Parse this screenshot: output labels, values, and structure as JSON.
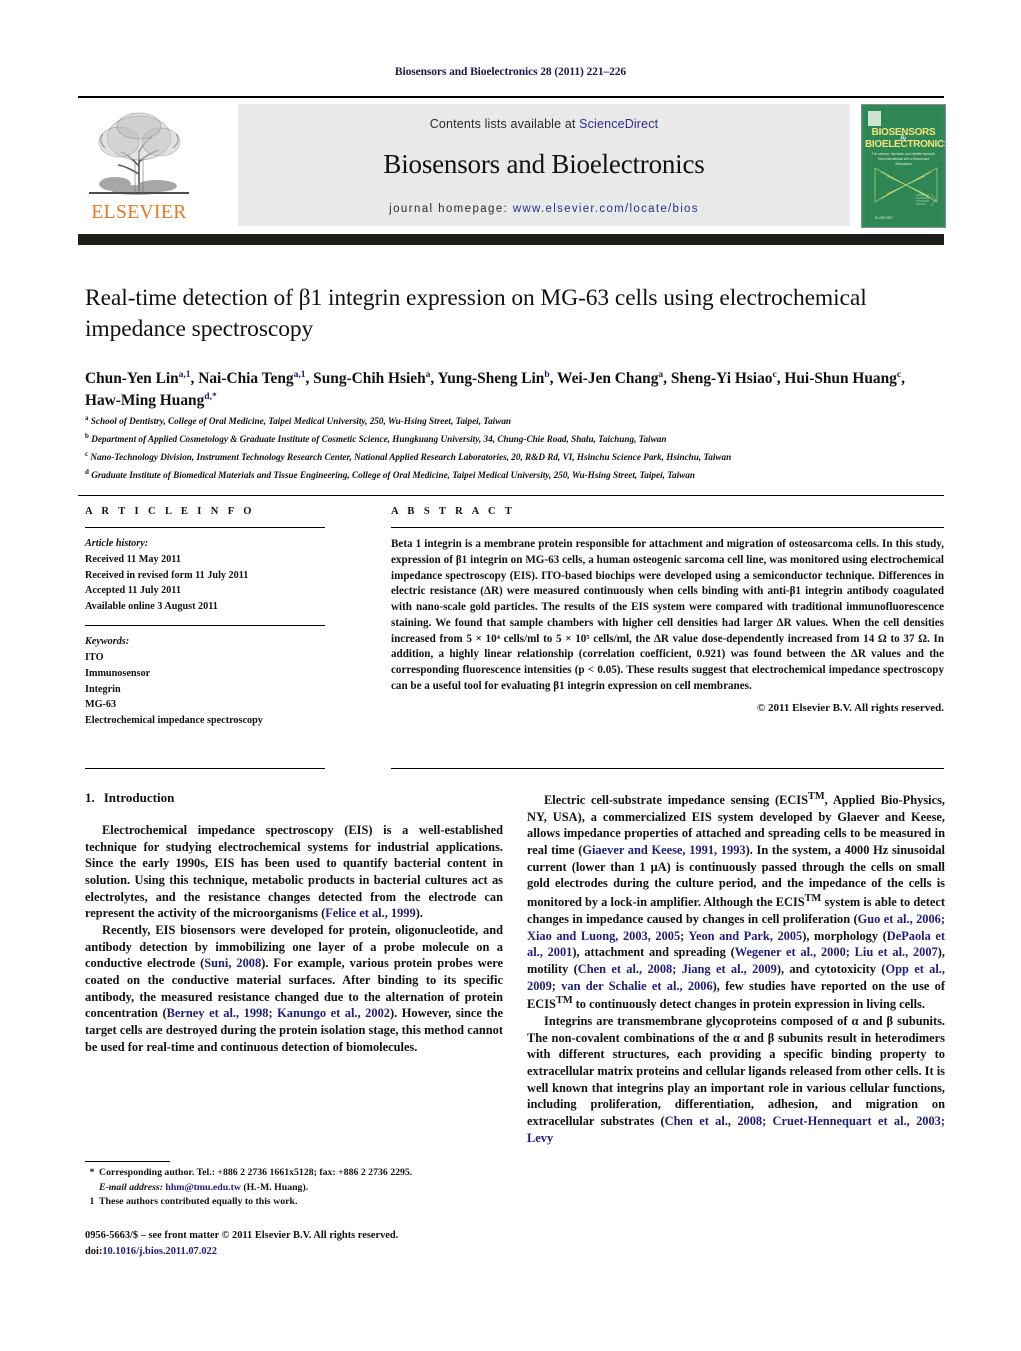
{
  "running_head": "Biosensors and Bioelectronics 28 (2011) 221–226",
  "masthead": {
    "contents_prefix": "Contents lists available at ",
    "sciencedirect": "ScienceDirect",
    "journal_name": "Biosensors and Bioelectronics",
    "homepage_label": "journal homepage:",
    "homepage_url": "www.elsevier.com/locate/bios",
    "publisher_logo_text": "ELSEVIER",
    "cover": {
      "line1": "BIOSENSORS",
      "amp": "&",
      "line2": "BIOELECTRONICS",
      "subtitle": "The science, handsets, and reliable research from International and a Recent and Bioanalysis",
      "imprint": "ELSEVIER"
    },
    "colors": {
      "sciencedirect_blue": "#2d2d8f",
      "elsevier_orange": "#e87722",
      "cover_green": "#2e8b57",
      "panel_grey": "#e9e9e9",
      "rule_black": "#1d1d1b"
    }
  },
  "article": {
    "title": "Real-time detection of β1 integrin expression on MG-63 cells using electrochemical impedance spectroscopy",
    "authors_html": "Chun-Yen Lin<sup>a,1</sup>, Nai-Chia Teng<sup>a,1</sup>, Sung-Chih Hsieh<sup>a</sup>, Yung-Sheng Lin<sup>b</sup>, Wei-Jen Chang<sup>a</sup>, Sheng-Yi Hsiao<sup>c</sup>, Hui-Shun Huang<sup>c</sup>, Haw-Ming Huang<sup>d,</sup><sup>*</sup>",
    "affiliations": [
      {
        "mark": "a",
        "text": "School of Dentistry, College of Oral Medicine, Taipei Medical University, 250, Wu-Hsing Street, Taipei, Taiwan"
      },
      {
        "mark": "b",
        "text": "Department of Applied Cosmetology & Graduate Institute of Cosmetic Science, Hungkuang University, 34, Chung-Chie Road, Shalu, Taichung, Taiwan"
      },
      {
        "mark": "c",
        "text": "Nano-Technology Division, Instrument Technology Research Center, National Applied Research Laboratories, 20, R&D Rd, VI, Hsinchu Science Park, Hsinchu, Taiwan"
      },
      {
        "mark": "d",
        "text": "Graduate Institute of Biomedical Materials and Tissue Engineering, College of Oral Medicine, Taipei Medical University, 250, Wu-Hsing Street, Taipei, Taiwan"
      }
    ]
  },
  "article_info": {
    "heading": "A R T I C L E    I N F O",
    "history_label": "Article history:",
    "history": [
      "Received 11 May 2011",
      "Received in revised form 11 July 2011",
      "Accepted 11 July 2011",
      "Available online 3 August 2011"
    ],
    "keywords_label": "Keywords:",
    "keywords": [
      "ITO",
      "Immunosensor",
      "Integrin",
      "MG-63",
      "Electrochemical impedance spectroscopy"
    ]
  },
  "abstract": {
    "heading": "A B S T R A C T",
    "text": "Beta 1 integrin is a membrane protein responsible for attachment and migration of osteosarcoma cells. In this study, expression of β1 integrin on MG-63 cells, a human osteogenic sarcoma cell line, was monitored using electrochemical impedance spectroscopy (EIS). ITO-based biochips were developed using a semiconductor technique. Differences in electric resistance (ΔR) were measured continuously when cells binding with anti-β1 integrin antibody coagulated with nano-scale gold particles. The results of the EIS system were compared with traditional immunofluorescence staining. We found that sample chambers with higher cell densities had larger ΔR values. When the cell densities increased from 5 × 10⁴ cells/ml to 5 × 10⁵ cells/ml, the ΔR value dose-dependently increased from 14 Ω to 37 Ω. In addition, a highly linear relationship (correlation coefficient, 0.921) was found between the ΔR values and the corresponding fluorescence intensities (p < 0.05). These results suggest that electrochemical impedance spectroscopy can be a useful tool for evaluating β1 integrin expression on cell membranes.",
    "copyright": "© 2011 Elsevier B.V. All rights reserved."
  },
  "body": {
    "section_number": "1.",
    "section_title": "Introduction",
    "left_paragraphs_html": [
      "Electrochemical impedance spectroscopy (EIS) is a well-established technique for studying electrochemical systems for industrial applications. Since the early 1990s, EIS has been used to quantify bacterial content in solution. Using this technique, metabolic products in bacterial cultures act as electrolytes, and the resistance changes detected from the electrode can represent the activity of the microorganisms (<span class=\"ref\">Felice et al., 1999</span>).",
      "Recently, EIS biosensors were developed for protein, oligonucleotide, and antibody detection by immobilizing one layer of a probe molecule on a conductive electrode (<span class=\"ref\">Suni, 2008</span>). For example, various protein probes were coated on the conductive material surfaces. After binding to its specific antibody, the measured resistance changed due to the alternation of protein concentration (<span class=\"ref\">Berney et al., 1998; Kanungo et al., 2002</span>). However, since the target cells are destroyed during the protein isolation stage, this method cannot be used for real-time and continuous detection of biomolecules."
    ],
    "right_paragraphs_html": [
      "Electric cell-substrate impedance sensing (ECIS<sup>TM</sup>, Applied Bio-Physics, NY, USA), a commercialized EIS system developed by Glaever and Keese, allows impedance properties of attached and spreading cells to be measured in real time (<span class=\"ref\">Giaever and Keese, 1991, 1993</span>). In the system, a 4000 Hz sinusoidal current (lower than 1 μA) is continuously passed through the cells on small gold electrodes during the culture period, and the impedance of the cells is monitored by a lock-in amplifier. Although the ECIS<sup>TM</sup> system is able to detect changes in impedance caused by changes in cell proliferation (<span class=\"ref\">Guo et al., 2006; Xiao and Luong, 2003, 2005; Yeon and Park, 2005</span>), morphology (<span class=\"ref\">DePaola et al., 2001</span>), attachment and spreading (<span class=\"ref\">Wegener et al., 2000; Liu et al., 2007</span>), motility (<span class=\"ref\">Chen et al., 2008; Jiang et al., 2009</span>), and cytotoxicity (<span class=\"ref\">Opp et al., 2009; van der Schalie et al., 2006</span>), few studies have reported on the use of ECIS<sup>TM</sup> to continuously detect changes in protein expression in living cells.",
      "Integrins are transmembrane glycoproteins composed of α and β subunits. The non-covalent combinations of the α and β subunits result in heterodimers with different structures, each providing a specific binding property to extracellular matrix proteins and cellular ligands released from other cells. It is well known that integrins play an important role in various cellular functions, including proliferation, differentiation, adhesion, and migration on extracellular substrates (<span class=\"ref\">Chen et al., 2008; Cruet-Hennequart et al., 2003; Levy</span>"
    ]
  },
  "footnotes": [
    {
      "mark": "*",
      "html": "Corresponding author. Tel.: +886 2 2736 1661x5128; fax: +886 2 2736 2295.<br><span class=\"ital\">E-mail address:</span> <span class=\"mail\">hhm@tmu.edu.tw</span> (H.-M. Huang)."
    },
    {
      "mark": "1",
      "html": "These authors contributed equally to this work."
    }
  ],
  "imprint": {
    "line1": "0956-5663/$ – see front matter © 2011 Elsevier B.V. All rights reserved.",
    "doi_prefix": "doi:",
    "doi": "10.1016/j.bios.2011.07.022"
  }
}
